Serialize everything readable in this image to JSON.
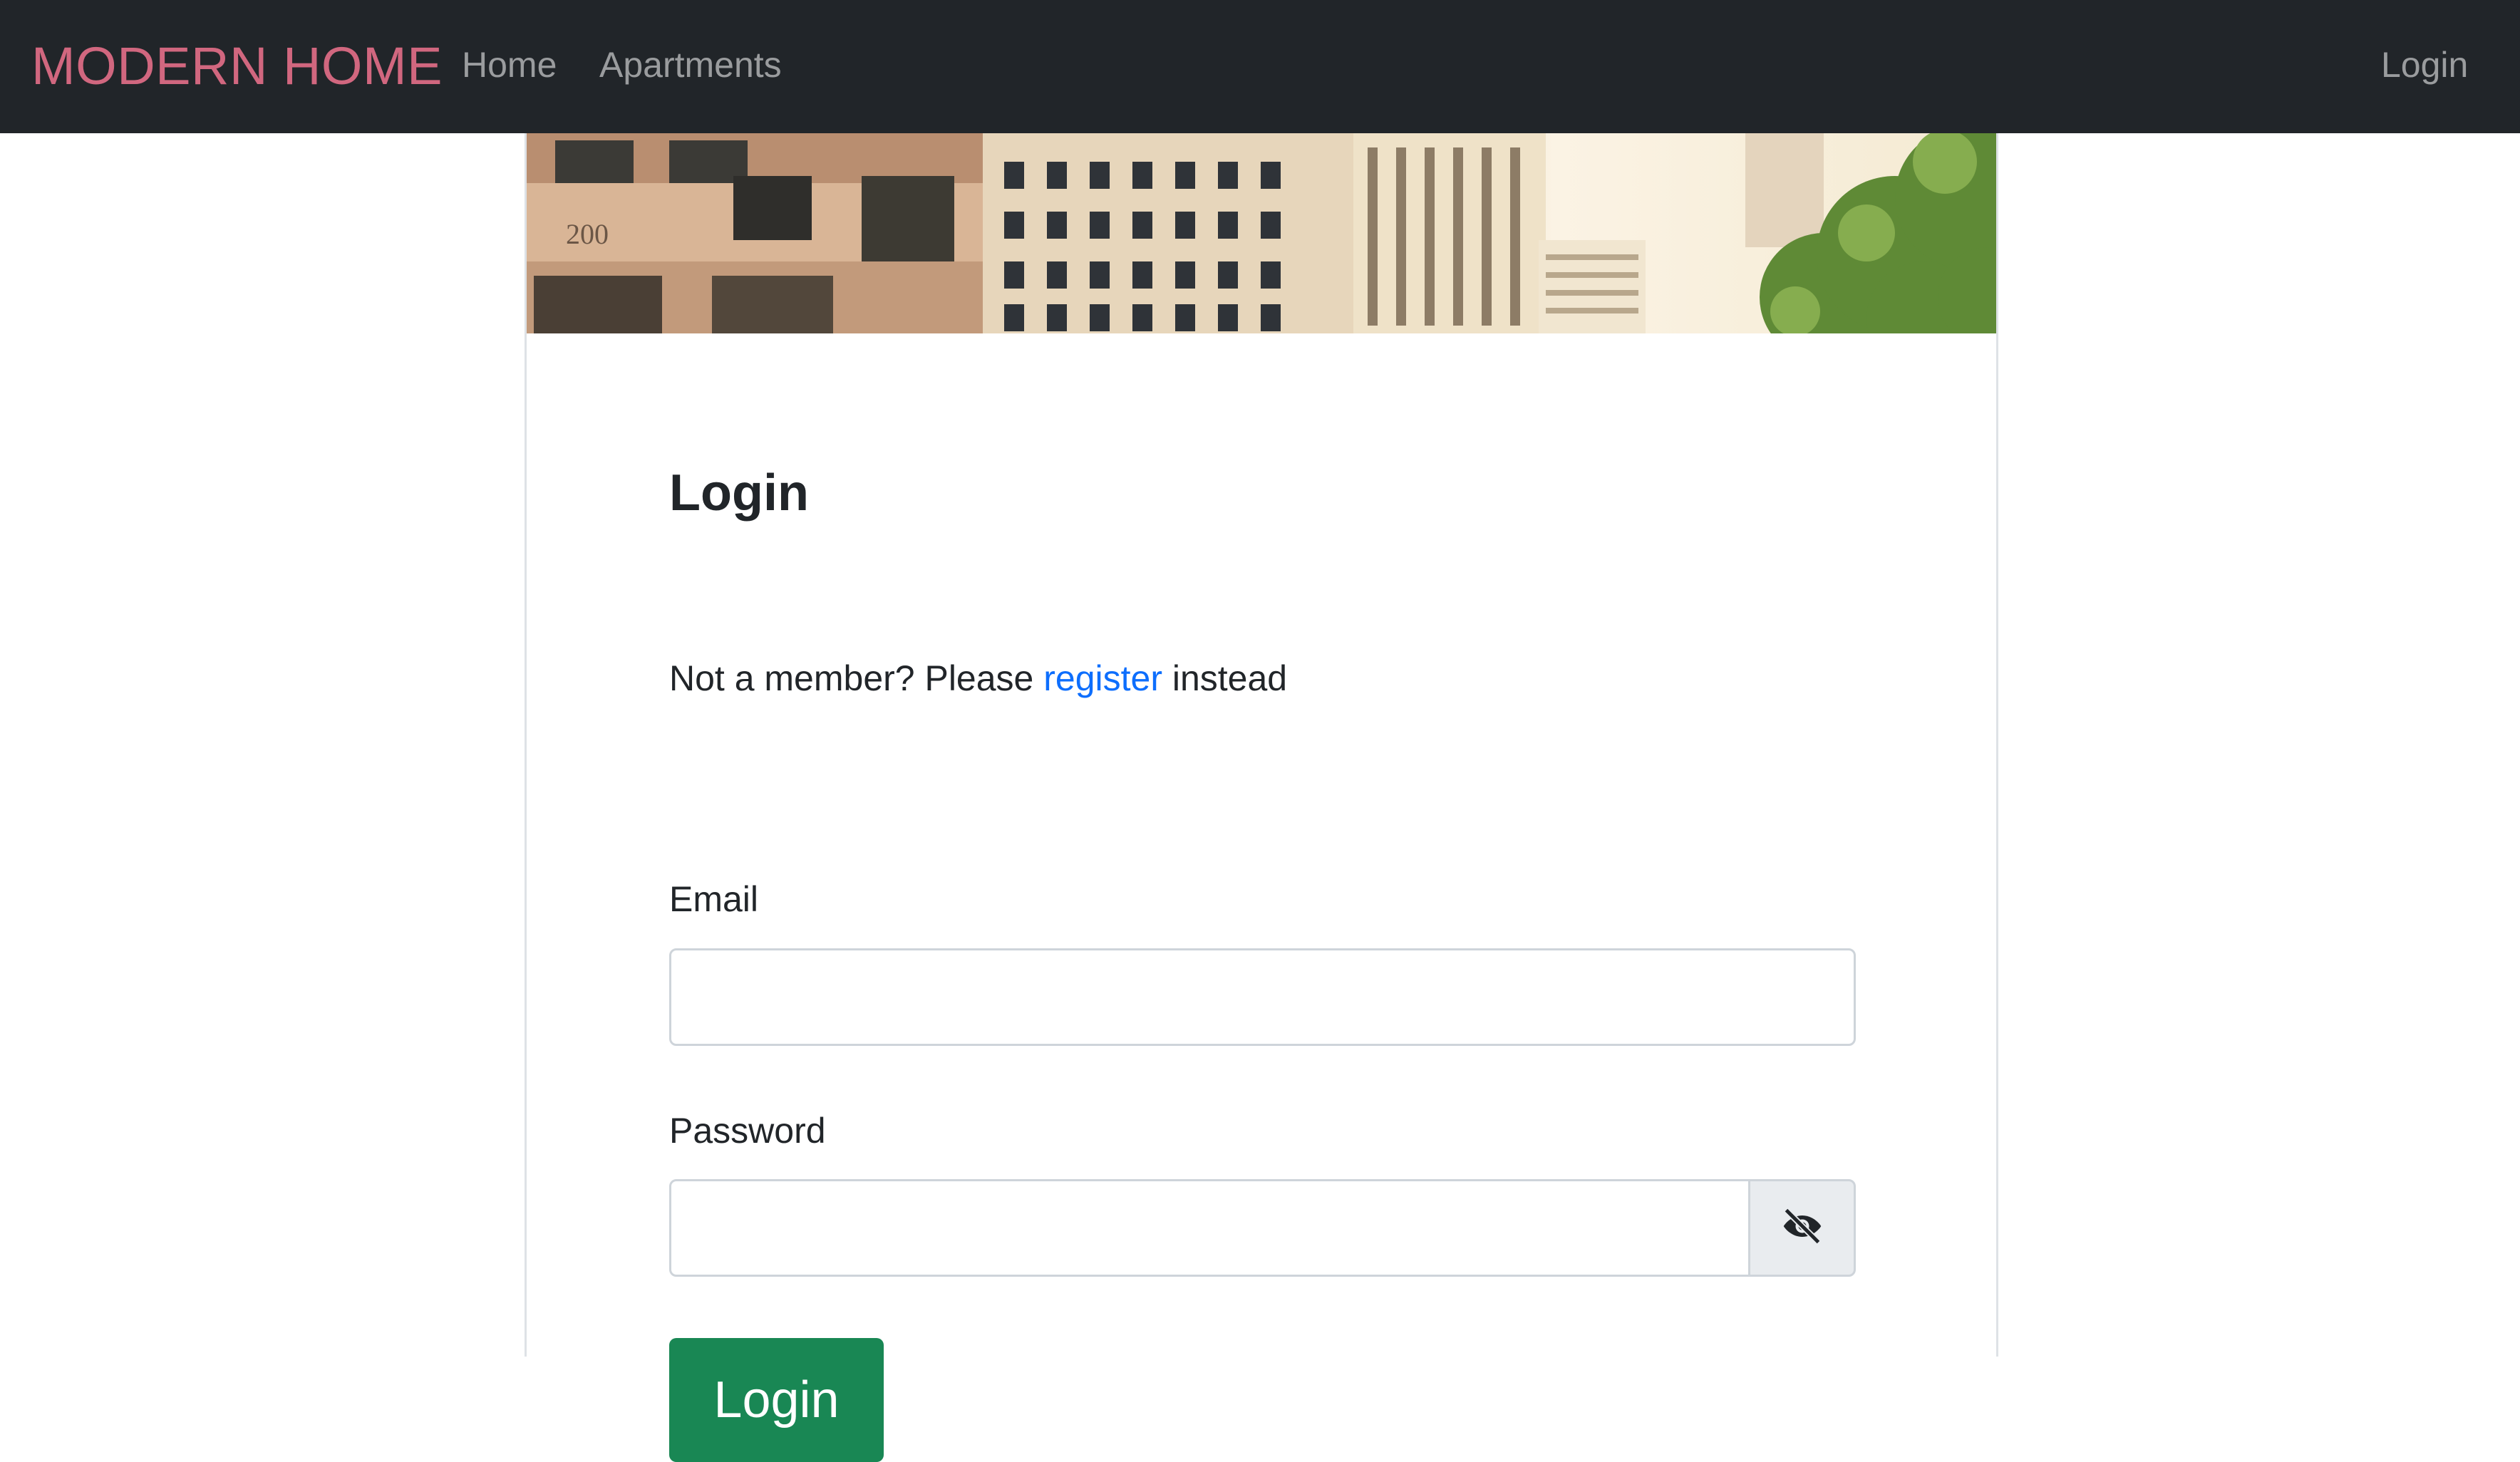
{
  "navbar": {
    "brand": "MODERN HOME",
    "links": [
      "Home",
      "Apartments"
    ],
    "login_label": "Login"
  },
  "colors": {
    "navbar_bg": "#212529",
    "brand": "#d1677f",
    "link": "#0d6efd",
    "primary_button": "#198754"
  },
  "login_card": {
    "title": "Login",
    "member_prefix": "Not a member? Please ",
    "register_link": "register",
    "member_suffix": " instead",
    "email_label": "Email",
    "email_value": "",
    "password_label": "Password",
    "password_value": "",
    "toggle_icon": "eye-slash-icon",
    "submit_label": "Login"
  }
}
